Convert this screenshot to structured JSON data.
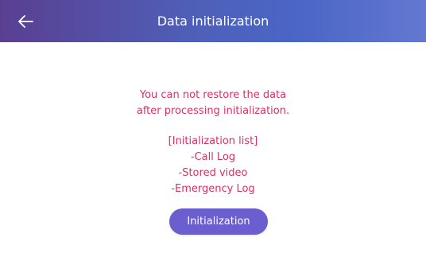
{
  "header": {
    "title": "Data initialization",
    "back_icon": "arrow-left-icon"
  },
  "message": {
    "line1": "You can not restore the data",
    "line2": "after processing initialization."
  },
  "init_list": {
    "heading": "[Initialization list]",
    "items": [
      "-Call Log",
      "-Stored video",
      "-Emergency Log"
    ]
  },
  "button": {
    "label": "Initialization"
  },
  "colors": {
    "header_start": "#5a3f91",
    "header_end": "#6478d0",
    "warning_text": "#d8306a",
    "button": "#6b5fd0"
  }
}
